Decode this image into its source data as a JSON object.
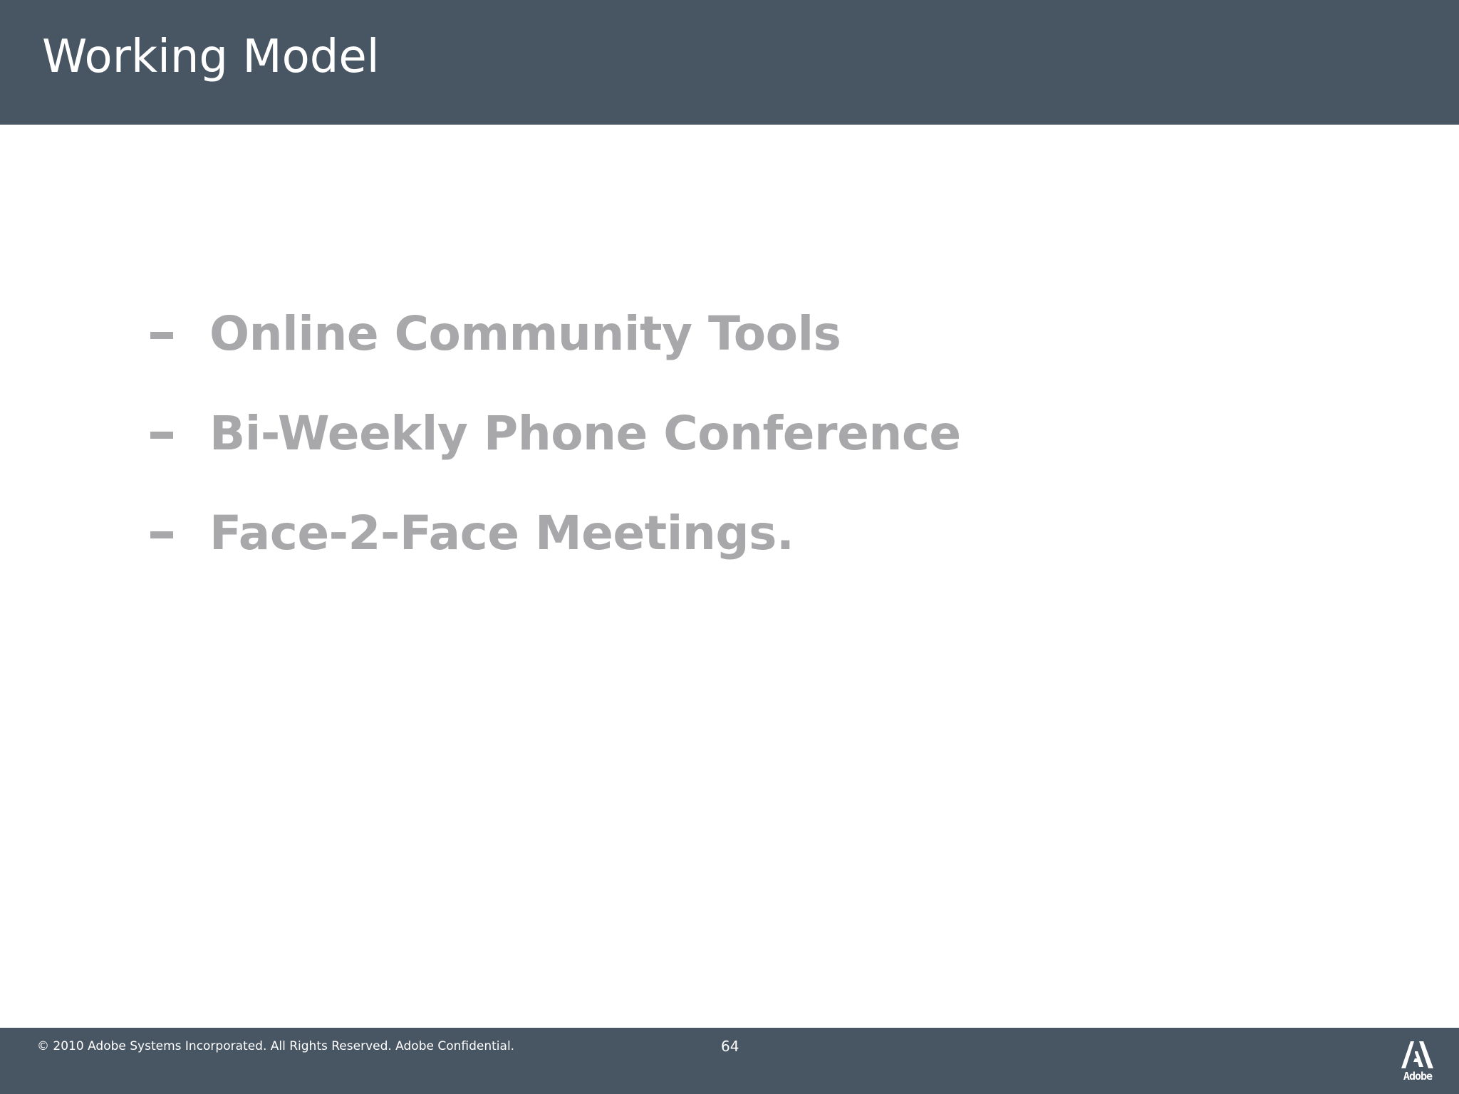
{
  "slide": {
    "title": "Working Model",
    "bullets": [
      "Online Community Tools",
      "Bi-Weekly Phone Conference",
      "Face-2-Face Meetings."
    ]
  },
  "footer": {
    "copyright": "© 2010 Adobe Systems Incorporated.  All Rights Reserved.  Adobe Confidential.",
    "page_number": "64",
    "logo_text": "Adobe",
    "logo_icon": "adobe-logo-icon"
  },
  "colors": {
    "bar": "#485563",
    "bullet_text": "#a8a7aa",
    "background": "#ffffff"
  }
}
